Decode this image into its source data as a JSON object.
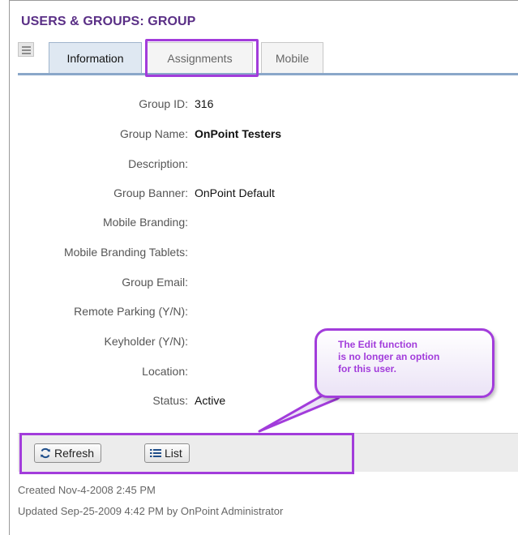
{
  "page": {
    "title": "USERS & GROUPS: GROUP"
  },
  "tabs": [
    {
      "label": "Information",
      "active": true
    },
    {
      "label": "Assignments",
      "active": false
    },
    {
      "label": "Mobile",
      "active": false
    }
  ],
  "fields": [
    {
      "label": "Group ID:",
      "value": "316",
      "bold": false
    },
    {
      "label": "Group Name:",
      "value": "OnPoint Testers",
      "bold": true
    },
    {
      "label": "Description:",
      "value": ""
    },
    {
      "label": "Group Banner:",
      "value": "OnPoint Default"
    },
    {
      "label": "Mobile Branding:",
      "value": ""
    },
    {
      "label": "Mobile Branding Tablets:",
      "value": ""
    },
    {
      "label": "Group Email:",
      "value": ""
    },
    {
      "label": "Remote Parking (Y/N):",
      "value": ""
    },
    {
      "label": "Keyholder (Y/N):",
      "value": ""
    },
    {
      "label": "Location:",
      "value": ""
    },
    {
      "label": "Status:",
      "value": "Active"
    }
  ],
  "toolbar": {
    "refresh_label": "Refresh",
    "list_label": "List"
  },
  "meta": {
    "created": "Created Nov-4-2008 2:45 PM",
    "updated": "Updated Sep-25-2009 4:42 PM by OnPoint Administrator"
  },
  "annotation": {
    "text": "The Edit function\nis no longer an option\nfor this user."
  },
  "colors": {
    "accent": "#a23cdb",
    "title": "#5a2f86",
    "tab_active_bg": "#dfe8f2",
    "tab_underline": "#8aa7c9"
  },
  "icons": {
    "menu": "menu-icon",
    "refresh": "refresh-icon",
    "list": "list-icon"
  }
}
